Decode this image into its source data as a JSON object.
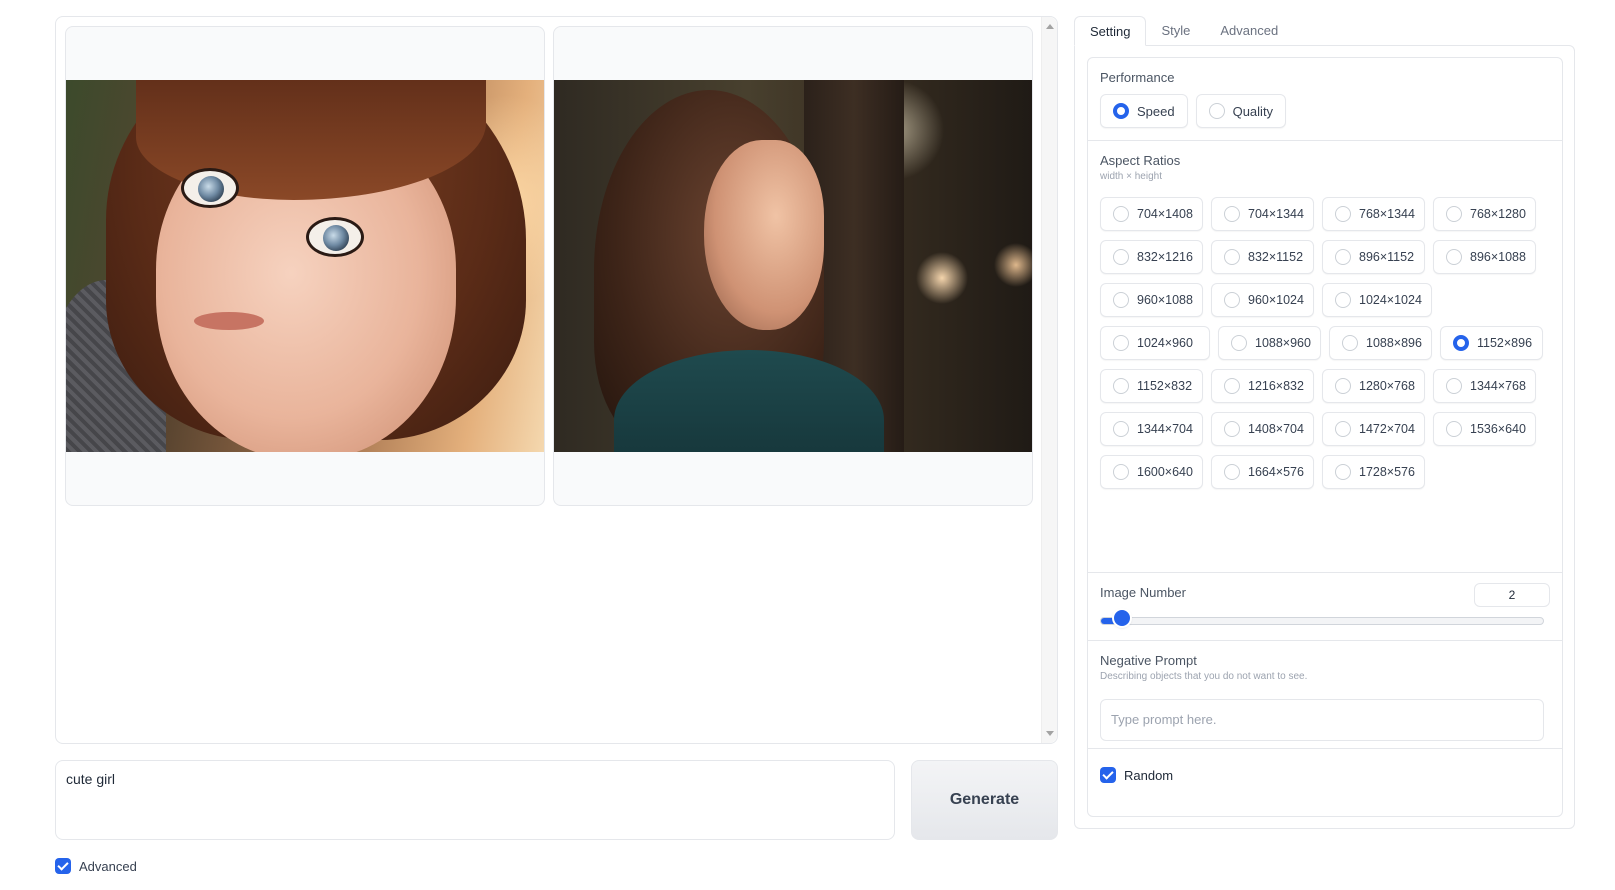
{
  "gallery": {
    "images": [
      {
        "name": "gallery-image-1"
      },
      {
        "name": "gallery-image-2"
      }
    ]
  },
  "prompt": {
    "value": "cute girl"
  },
  "generate_label": "Generate",
  "advanced": {
    "label": "Advanced",
    "checked": true
  },
  "tabs": [
    {
      "label": "Setting",
      "active": true
    },
    {
      "label": "Style",
      "active": false
    },
    {
      "label": "Advanced",
      "active": false
    }
  ],
  "performance": {
    "label": "Performance",
    "options": [
      {
        "label": "Speed",
        "checked": true
      },
      {
        "label": "Quality",
        "checked": false
      }
    ]
  },
  "aspect": {
    "label": "Aspect Ratios",
    "sublabel": "width × height",
    "selected": "1152×896",
    "options": [
      "704×1408",
      "704×1344",
      "768×1344",
      "768×1280",
      "832×1216",
      "832×1152",
      "896×1152",
      "896×1088",
      "960×1088",
      "960×1024",
      "1024×1024",
      "1024×960",
      "1088×960",
      "1088×896",
      "1152×896",
      "1152×832",
      "1216×832",
      "1280×768",
      "1344×768",
      "1344×704",
      "1408×704",
      "1472×704",
      "1536×640",
      "1600×640",
      "1664×576",
      "1728×576"
    ]
  },
  "image_number": {
    "label": "Image Number",
    "value": "2",
    "min": 1,
    "max": 32
  },
  "negative": {
    "label": "Negative Prompt",
    "sublabel": "Describing objects that you do not want to see.",
    "placeholder": "Type prompt here."
  },
  "random": {
    "label": "Random",
    "checked": true
  },
  "colors": {
    "accent": "#2563eb",
    "border": "#e5e7eb"
  }
}
